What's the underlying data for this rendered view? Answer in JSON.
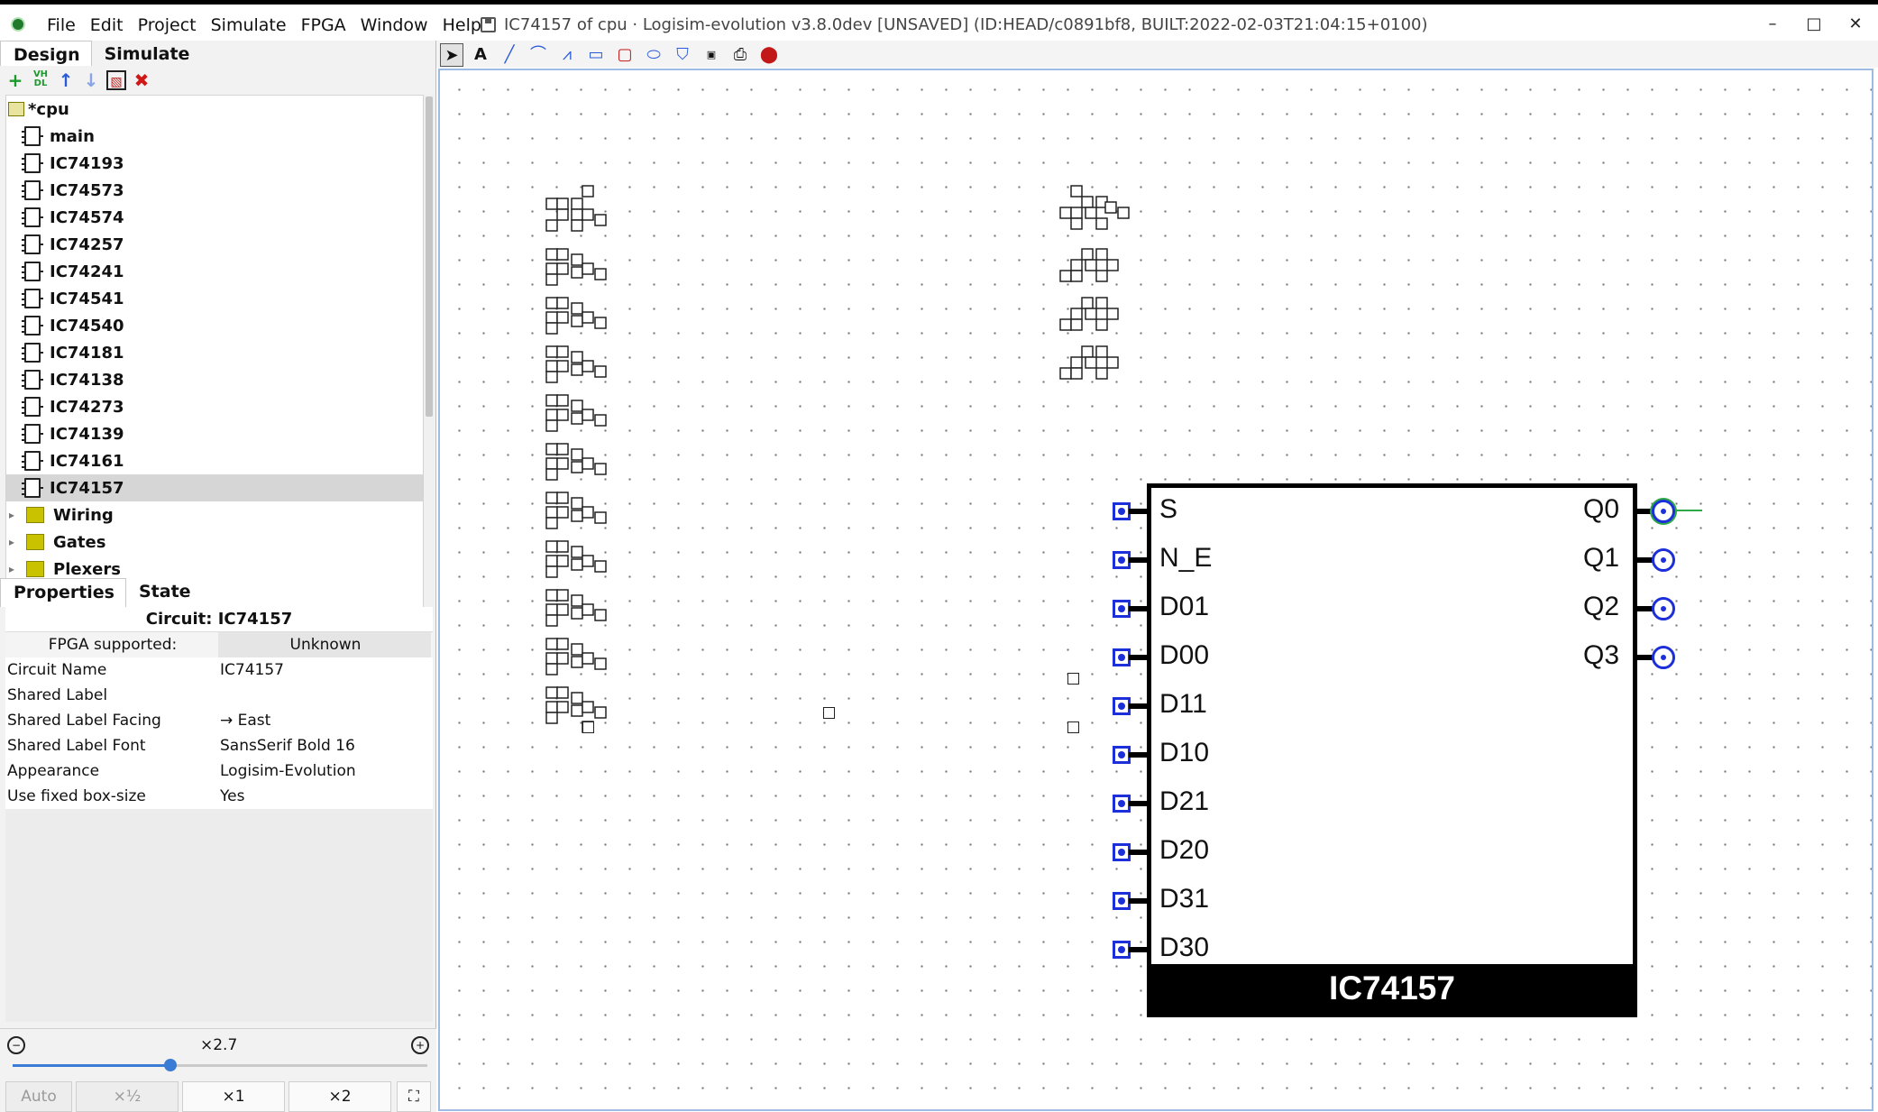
{
  "window": {
    "title": "IC74157 of cpu · Logisim-evolution v3.8.0dev [UNSAVED] (ID:HEAD/c0891bf8, BUILT:2022-02-03T21:04:15+0100)",
    "minimize": "–",
    "maximize": "□",
    "close": "✕"
  },
  "menu": [
    "File",
    "Edit",
    "Project",
    "Simulate",
    "FPGA",
    "Window",
    "Help"
  ],
  "left_tabs": {
    "design": "Design",
    "simulate": "Simulate"
  },
  "tree_toolbar": {
    "add": "+",
    "vhdl": "VH DL",
    "up": "↑",
    "down": "↓",
    "edit": "▧",
    "delete": "✖"
  },
  "tree": {
    "project": "*cpu",
    "circuits": [
      "main",
      "IC74193",
      "IC74573",
      "IC74574",
      "IC74257",
      "IC74241",
      "IC74541",
      "IC74540",
      "IC74181",
      "IC74138",
      "IC74273",
      "IC74139",
      "IC74161",
      "IC74157"
    ],
    "selected": "IC74157",
    "libraries": [
      "Wiring",
      "Gates",
      "Plexers"
    ]
  },
  "props_tabs": {
    "properties": "Properties",
    "state": "State"
  },
  "properties": {
    "title": "Circuit: IC74157",
    "fpga_label": "FPGA supported:",
    "fpga_value": "Unknown",
    "rows": [
      {
        "key": "Circuit Name",
        "value": "IC74157"
      },
      {
        "key": "Shared Label",
        "value": ""
      },
      {
        "key": "Shared Label Facing",
        "value": "→ East"
      },
      {
        "key": "Shared Label Font",
        "value": "SansSerif Bold 16"
      },
      {
        "key": "Appearance",
        "value": "Logisim-Evolution"
      },
      {
        "key": "Use fixed box-size",
        "value": "Yes"
      }
    ]
  },
  "zoom": {
    "label": "×2.7",
    "level": 0.38,
    "buttons": [
      "Auto",
      "×½",
      "×1",
      "×2"
    ]
  },
  "draw_tools": [
    "select-tool",
    "text-tool",
    "line-tool",
    "curve-tool",
    "polyline-tool",
    "rect-tool",
    "rounded-rect-tool",
    "oval-tool",
    "polygon-tool",
    "pin-tool",
    "port-tool",
    "led-tool"
  ],
  "chip": {
    "name": "IC74157",
    "inputs": [
      "S",
      "N_E",
      "D01",
      "D00",
      "D11",
      "D10",
      "D21",
      "D20",
      "D31",
      "D30"
    ],
    "outputs": [
      "Q0",
      "Q1",
      "Q2",
      "Q3"
    ]
  },
  "colors": {
    "pin": "#1d2fd8",
    "wire": "#2fa84a",
    "canvas_border": "#9dbbe4"
  }
}
